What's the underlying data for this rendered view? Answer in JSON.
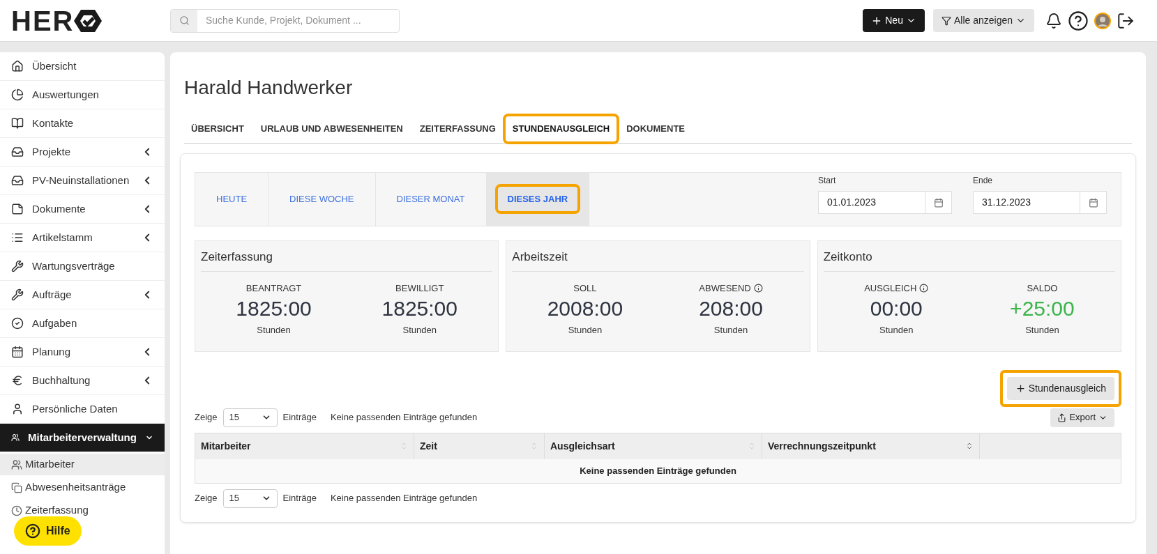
{
  "header": {
    "logo": "HER",
    "search": {
      "placeholder": "Suche Kunde, Projekt, Dokument ..."
    },
    "new_button": "Neu",
    "filter_button": "Alle anzeigen"
  },
  "sidebar": {
    "items": [
      {
        "label": "Übersicht",
        "has_children": false,
        "expanded": false
      },
      {
        "label": "Auswertungen",
        "has_children": false,
        "expanded": false
      },
      {
        "label": "Kontakte",
        "has_children": false,
        "expanded": false
      },
      {
        "label": "Projekte",
        "has_children": true,
        "expanded": false
      },
      {
        "label": "PV-Neuinstallationen",
        "has_children": true,
        "expanded": false
      },
      {
        "label": "Dokumente",
        "has_children": true,
        "expanded": false
      },
      {
        "label": "Artikelstamm",
        "has_children": true,
        "expanded": false
      },
      {
        "label": "Wartungsverträge",
        "has_children": false,
        "expanded": false
      },
      {
        "label": "Aufträge",
        "has_children": true,
        "expanded": false
      },
      {
        "label": "Aufgaben",
        "has_children": false,
        "expanded": false
      },
      {
        "label": "Planung",
        "has_children": true,
        "expanded": false
      },
      {
        "label": "Buchhaltung",
        "has_children": true,
        "expanded": false
      },
      {
        "label": "Persönliche Daten",
        "has_children": false,
        "expanded": false
      },
      {
        "label": "Mitarbeiterverwaltung",
        "has_children": true,
        "expanded": true,
        "children": [
          {
            "label": "Mitarbeiter",
            "selected": true
          },
          {
            "label": "Abwesenheitsanträge",
            "selected": false
          },
          {
            "label": "Zeiterfassung",
            "selected": false
          }
        ]
      }
    ]
  },
  "help_button": "Hilfe",
  "page": {
    "title": "Harald Handwerker",
    "tabs": [
      {
        "label": "ÜBERSICHT",
        "selected": false,
        "highlighted": false
      },
      {
        "label": "URLAUB UND ABWESENHEITEN",
        "selected": false,
        "highlighted": false
      },
      {
        "label": "ZEITERFASSUNG",
        "selected": false,
        "highlighted": false
      },
      {
        "label": "STUNDENAUSGLEICH",
        "selected": true,
        "highlighted": true
      },
      {
        "label": "DOKUMENTE",
        "selected": false,
        "highlighted": false
      }
    ],
    "periods": [
      {
        "label": "HEUTE",
        "selected": false,
        "highlighted": false
      },
      {
        "label": "DIESE WOCHE",
        "selected": false,
        "highlighted": false
      },
      {
        "label": "DIESER MONAT",
        "selected": false,
        "highlighted": false
      },
      {
        "label": "DIESES JAHR",
        "selected": true,
        "highlighted": true
      }
    ],
    "start": {
      "label": "Start",
      "value": "01.01.2023"
    },
    "end": {
      "label": "Ende",
      "value": "31.12.2023"
    },
    "stat_cards": [
      {
        "title": "Zeiterfassung",
        "stats": [
          {
            "label": "BEANTRAGT",
            "info": false,
            "value": "1825:00",
            "unit": "Stunden",
            "positive": false
          },
          {
            "label": "BEWILLIGT",
            "info": false,
            "value": "1825:00",
            "unit": "Stunden",
            "positive": false
          }
        ]
      },
      {
        "title": "Arbeitszeit",
        "stats": [
          {
            "label": "SOLL",
            "info": false,
            "value": "2008:00",
            "unit": "Stunden",
            "positive": false
          },
          {
            "label": "ABWESEND",
            "info": true,
            "value": "208:00",
            "unit": "Stunden",
            "positive": false
          }
        ]
      },
      {
        "title": "Zeitkonto",
        "stats": [
          {
            "label": "AUSGLEICH",
            "info": true,
            "value": "00:00",
            "unit": "Stunden",
            "positive": false
          },
          {
            "label": "SALDO",
            "info": false,
            "value": "+25:00",
            "unit": "Stunden",
            "positive": true
          }
        ]
      }
    ],
    "add_button": {
      "label": "Stundenausgleich",
      "highlighted": true
    },
    "export_button": "Export",
    "top_pager": {
      "prefix": "Zeige",
      "value": "15",
      "suffix": "Einträge",
      "info": "Keine passenden Einträge gefunden"
    },
    "table": {
      "columns": [
        {
          "label": "Mitarbeiter",
          "sorted": false
        },
        {
          "label": "Zeit",
          "sorted": false
        },
        {
          "label": "Ausgleichsart",
          "sorted": false
        },
        {
          "label": "Verrechnungszeitpunkt",
          "sorted": true
        }
      ],
      "empty": "Keine passenden Einträge gefunden"
    },
    "bottom_pager": {
      "prefix": "Zeige",
      "value": "15",
      "suffix": "Einträge",
      "info": "Keine passenden Einträge gefunden"
    }
  }
}
